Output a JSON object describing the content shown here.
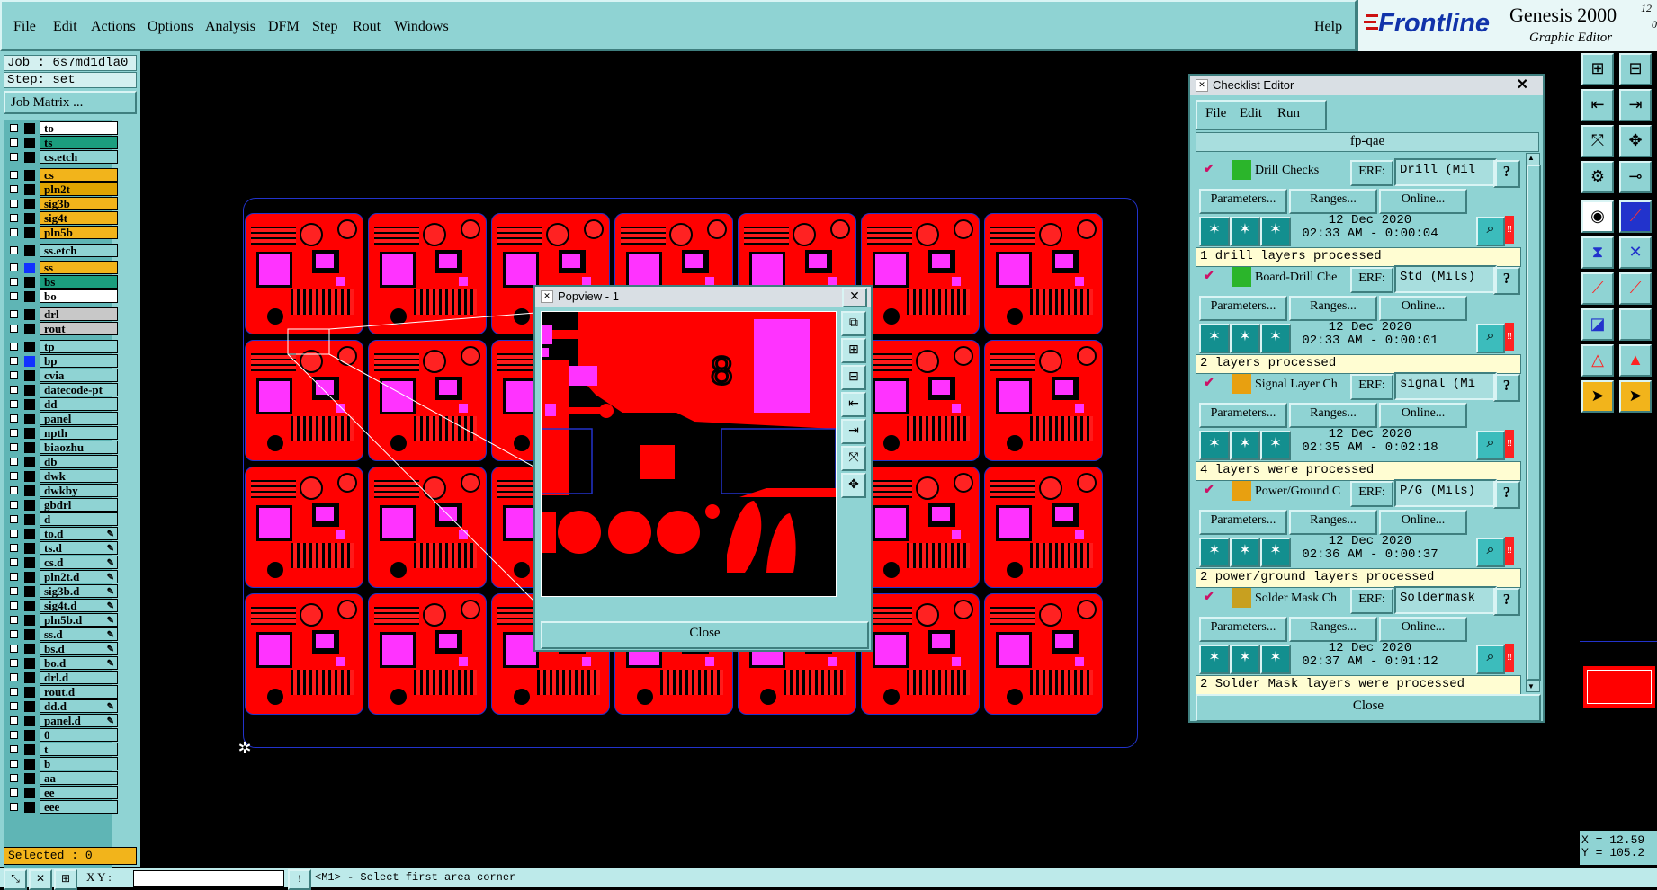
{
  "app": {
    "brand": "Frontline",
    "product": "Genesis 2000",
    "version_fragment": "12",
    "version_fragment2": "0.",
    "subtitle": "Graphic Editor"
  },
  "menu": [
    "File",
    "Edit",
    "Actions",
    "Options",
    "Analysis",
    "DFM",
    "Step",
    "Rout",
    "Windows"
  ],
  "help_label": "Help",
  "left": {
    "job": "Job : 6s7md1dla0",
    "step": "Step: set",
    "job_matrix_label": "Job Matrix ...",
    "selected": "Selected : 0"
  },
  "layers": [
    {
      "name": "to",
      "color": "#ffffff"
    },
    {
      "name": "ts",
      "color": "#1b9e7e"
    },
    {
      "name": "cs.etch",
      "color": "#8fd3d3"
    },
    {
      "name": "cs",
      "color": "#f2b41b"
    },
    {
      "name": "pln2t",
      "color": "#e0a400"
    },
    {
      "name": "sig3b",
      "color": "#f2b41b"
    },
    {
      "name": "sig4t",
      "color": "#f2b41b"
    },
    {
      "name": "pln5b",
      "color": "#f2b41b"
    },
    {
      "name": "ss.etch",
      "color": "#8fd3d3"
    },
    {
      "name": "ss",
      "color": "#f2b41b"
    },
    {
      "name": "bs",
      "color": "#1b9e7e"
    },
    {
      "name": "bo",
      "color": "#ffffff"
    },
    {
      "name": "drl",
      "color": "#c8c8c8"
    },
    {
      "name": "rout",
      "color": "#c8c8c8"
    },
    {
      "name": "tp",
      "color": "#8fd3d3"
    },
    {
      "name": "bp",
      "color": "#8fd3d3"
    },
    {
      "name": "cvia",
      "color": "#8fd3d3"
    },
    {
      "name": "datecode-pt",
      "color": "#8fd3d3"
    },
    {
      "name": "dd",
      "color": "#8fd3d3"
    },
    {
      "name": "panel",
      "color": "#8fd3d3"
    },
    {
      "name": "npth",
      "color": "#8fd3d3"
    },
    {
      "name": "biaozhu",
      "color": "#8fd3d3"
    },
    {
      "name": "db",
      "color": "#8fd3d3"
    },
    {
      "name": "dwk",
      "color": "#8fd3d3"
    },
    {
      "name": "dwkby",
      "color": "#8fd3d3"
    },
    {
      "name": "gbdrl",
      "color": "#8fd3d3"
    },
    {
      "name": "d",
      "color": "#8fd3d3"
    },
    {
      "name": "to.d",
      "color": "#8fd3d3"
    },
    {
      "name": "ts.d",
      "color": "#8fd3d3"
    },
    {
      "name": "cs.d",
      "color": "#8fd3d3"
    },
    {
      "name": "pln2t.d",
      "color": "#8fd3d3"
    },
    {
      "name": "sig3b.d",
      "color": "#8fd3d3"
    },
    {
      "name": "sig4t.d",
      "color": "#8fd3d3"
    },
    {
      "name": "pln5b.d",
      "color": "#8fd3d3"
    },
    {
      "name": "ss.d",
      "color": "#8fd3d3"
    },
    {
      "name": "bs.d",
      "color": "#8fd3d3"
    },
    {
      "name": "bo.d",
      "color": "#8fd3d3"
    },
    {
      "name": "drl.d",
      "color": "#8fd3d3"
    },
    {
      "name": "rout.d",
      "color": "#8fd3d3"
    },
    {
      "name": "dd.d",
      "color": "#8fd3d3"
    },
    {
      "name": "panel.d",
      "color": "#8fd3d3"
    },
    {
      "name": "0",
      "color": "#8fd3d3"
    },
    {
      "name": "t",
      "color": "#8fd3d3"
    },
    {
      "name": "b",
      "color": "#8fd3d3"
    },
    {
      "name": "aa",
      "color": "#8fd3d3"
    },
    {
      "name": "ee",
      "color": "#8fd3d3"
    },
    {
      "name": "eee",
      "color": "#8fd3d3"
    }
  ],
  "status": {
    "xy_label": "X Y :",
    "message": "<M1> - Select first area corner"
  },
  "popview": {
    "title": "Popview - 1",
    "close_label": "Close",
    "number_text": "8"
  },
  "checklist": {
    "title": "Checklist Editor",
    "menu": [
      "File",
      "Edit",
      "Run"
    ],
    "name": "fp-qae",
    "close_label": "Close",
    "erf_label": "ERF:",
    "parameters_label": "Parameters...",
    "ranges_label": "Ranges...",
    "online_label": "Online...",
    "help_label": "?",
    "entries": [
      {
        "name": "Drill Checks",
        "erf": "Drill (Mil",
        "date": "12 Dec 2020",
        "time": "02:33 AM - 0:00:04",
        "result": "1 drill layers processed"
      },
      {
        "name": "Board-Drill Che",
        "erf": "Std (Mils)",
        "date": "12 Dec 2020",
        "time": "02:33 AM - 0:00:01",
        "result": "2 layers processed"
      },
      {
        "name": "Signal Layer Ch",
        "erf": "signal (Mi",
        "date": "12 Dec 2020",
        "time": "02:35 AM - 0:02:18",
        "result": "4 layers were processed"
      },
      {
        "name": "Power/Ground C",
        "erf": "P/G (Mils)",
        "date": "12 Dec 2020",
        "time": "02:36 AM - 0:00:37",
        "result": "2 power/ground layers processed"
      },
      {
        "name": "Solder Mask Ch",
        "erf": "Soldermask",
        "date": "12 Dec 2020",
        "time": "02:37 AM - 0:01:12",
        "result": "2 Solder Mask layers were processed"
      }
    ]
  },
  "coords": {
    "x": "X = 12.59",
    "y": "Y = 105.2"
  }
}
